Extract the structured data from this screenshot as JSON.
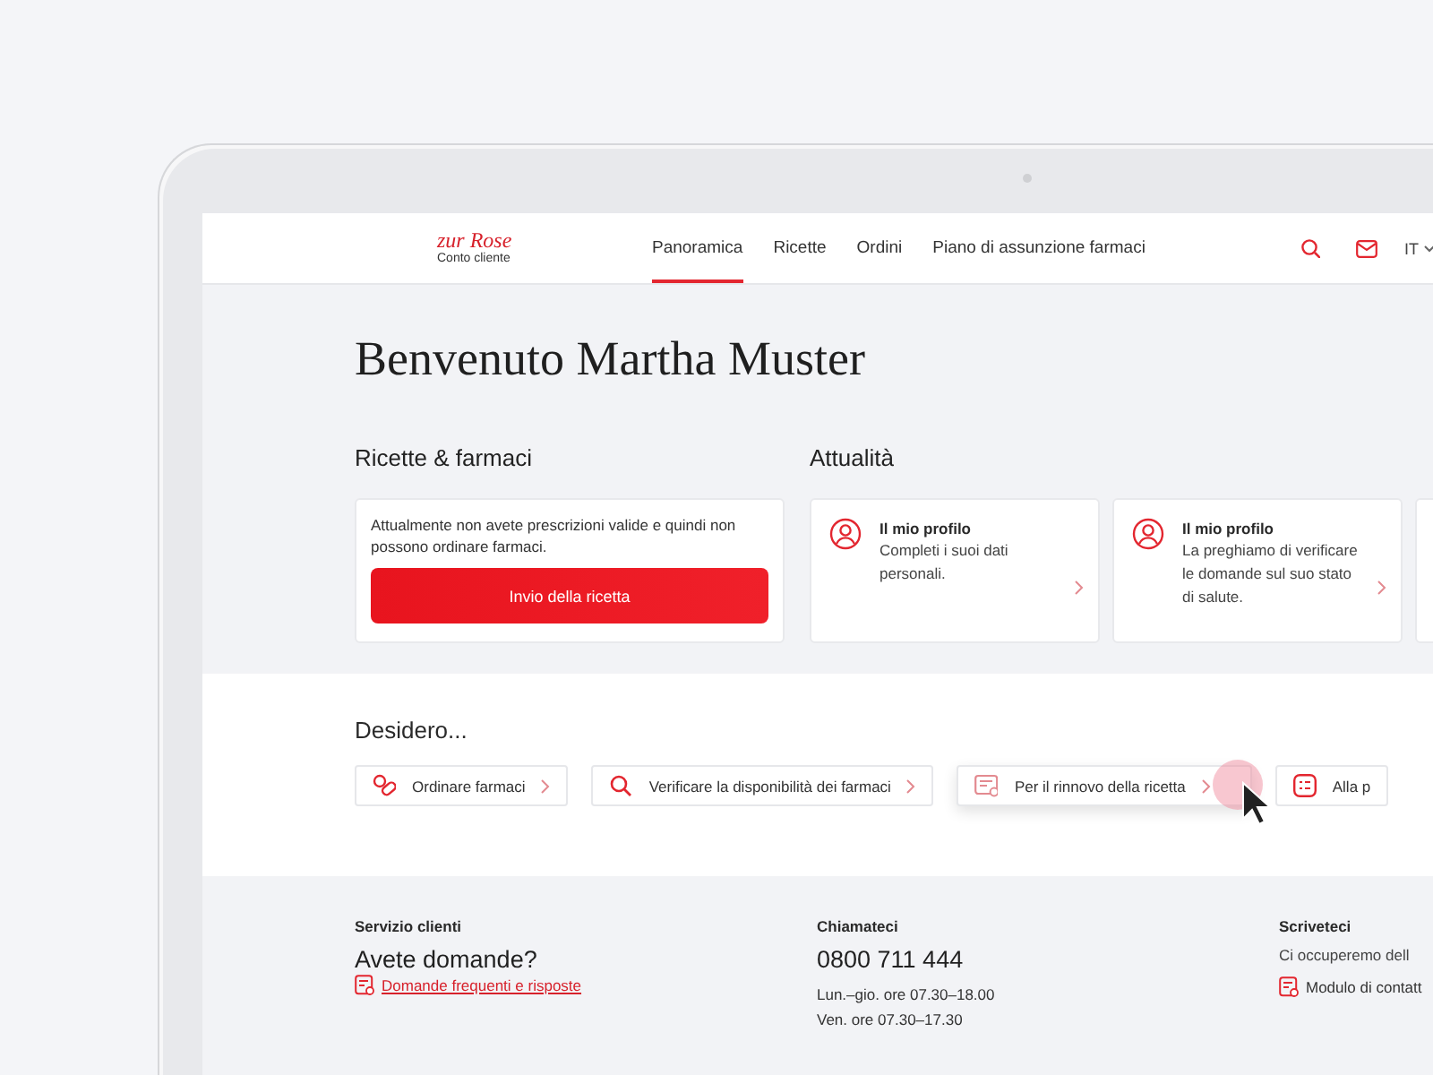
{
  "header": {
    "logo": {
      "brand": "zur Rose",
      "subtitle": "Conto cliente"
    },
    "nav": [
      {
        "label": "Panoramica",
        "selected": true
      },
      {
        "label": "Ricette",
        "selected": false
      },
      {
        "label": "Ordini",
        "selected": false
      },
      {
        "label": "Piano di assunzione farmaci",
        "selected": false
      }
    ],
    "language": "IT"
  },
  "title": "Benvenuto Martha Muster",
  "prescriptions": {
    "heading": "Ricette & farmaci",
    "message": "Attualmente non avete prescrizioni valide e quindi non possono ordinare farmaci.",
    "button": "Invio della ricetta"
  },
  "news": {
    "heading": "Attualità",
    "items": [
      {
        "title": "Il mio profilo",
        "text": "Completi i suoi dati personali."
      },
      {
        "title": "Il mio profilo",
        "text": "La preghiamo di verificare le domande sul suo stato di salute."
      }
    ]
  },
  "actions": {
    "heading": "Desidero...",
    "items": [
      {
        "kind": "pills",
        "label": "Ordinare farmaci",
        "hovered": false
      },
      {
        "kind": "search",
        "label": "Verificare la disponibilità dei farmaci",
        "hovered": false
      },
      {
        "kind": "prescription",
        "label": "Per il rinnovo della ricetta",
        "hovered": true
      },
      {
        "kind": "list",
        "label": "Alla p",
        "hovered": false
      }
    ]
  },
  "footer": {
    "columns": [
      {
        "heading": "Servizio clienti",
        "title": "Avete domande?",
        "link": "Domande frequenti e risposte"
      },
      {
        "heading": "Chiamateci",
        "title": "0800 711 444",
        "lines": [
          "Lun.–gio. ore 07.30–18.00",
          "Ven. ore 07.30–17.30"
        ]
      },
      {
        "heading": "Scriveteci",
        "text": "Ci occuperemo dell",
        "link": "Modulo di contatt"
      }
    ]
  }
}
